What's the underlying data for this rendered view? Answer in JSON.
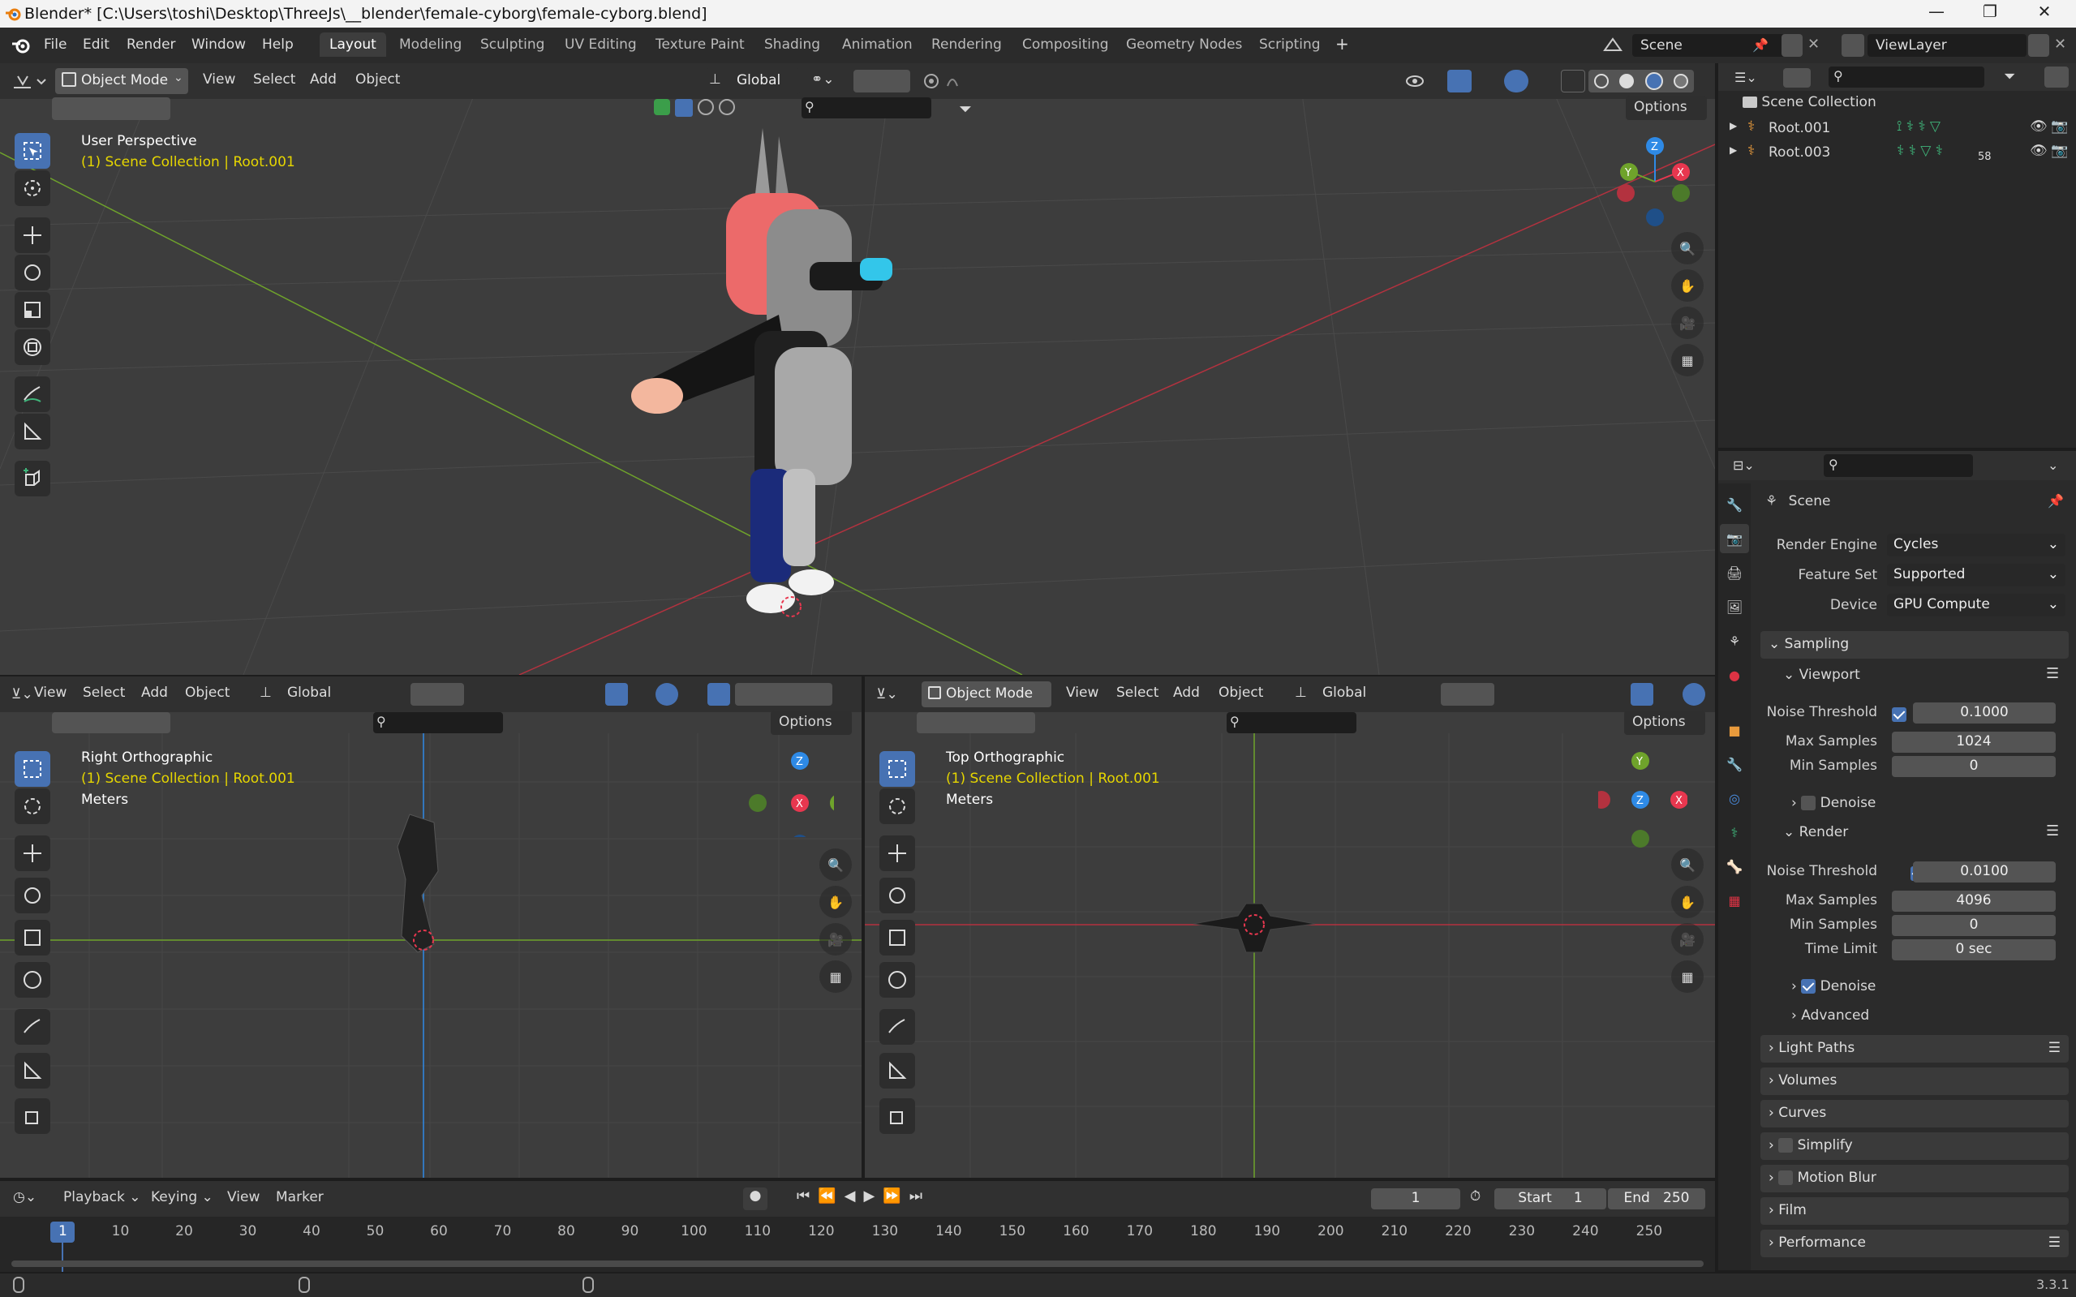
{
  "window": {
    "title": "Blender* [C:\\Users\\toshi\\Desktop\\ThreeJs\\__blender\\female-cyborg\\female-cyborg.blend]",
    "minimize": "—",
    "maximize": "❐",
    "close": "✕"
  },
  "menu": [
    "File",
    "Edit",
    "Render",
    "Window",
    "Help"
  ],
  "workspaces": [
    "Layout",
    "Modeling",
    "Sculpting",
    "UV Editing",
    "Texture Paint",
    "Shading",
    "Animation",
    "Rendering",
    "Compositing",
    "Geometry Nodes",
    "Scripting"
  ],
  "add_workspace": "+",
  "scene_name": "Scene",
  "view_layer": "ViewLayer",
  "main_view": {
    "mode": "Object Mode",
    "menus": [
      "View",
      "Select",
      "Add",
      "Object"
    ],
    "orientation": "Global",
    "options": "Options",
    "perspective": "User Perspective",
    "collection": "(1) Scene Collection | Root.001"
  },
  "left_view": {
    "menus": [
      "View",
      "Select",
      "Add",
      "Object"
    ],
    "orientation": "Global",
    "options": "Options",
    "perspective": "Right Orthographic",
    "collection": "(1) Scene Collection | Root.001",
    "units": "Meters"
  },
  "right_view": {
    "mode": "Object Mode",
    "menus": [
      "View",
      "Select",
      "Add",
      "Object"
    ],
    "orientation": "Global",
    "options": "Options",
    "perspective": "Top Orthographic",
    "collection": "(1) Scene Collection | Root.001",
    "units": "Meters"
  },
  "outliner": {
    "root": "Scene Collection",
    "items": [
      {
        "name": "Root.001"
      },
      {
        "name": "Root.003",
        "badge": "58"
      }
    ]
  },
  "properties": {
    "context": "Scene",
    "render_engine_label": "Render Engine",
    "render_engine": "Cycles",
    "feature_set_label": "Feature Set",
    "feature_set": "Supported",
    "device_label": "Device",
    "device": "GPU Compute",
    "sampling": "Sampling",
    "viewport": "Viewport",
    "vp_noise_label": "Noise Threshold",
    "vp_noise": "0.1000",
    "vp_max_label": "Max Samples",
    "vp_max": "1024",
    "vp_min_label": "Min Samples",
    "vp_min": "0",
    "denoise_label": "Denoise",
    "render": "Render",
    "r_noise_label": "Noise Threshold",
    "r_noise": "0.0100",
    "r_max_label": "Max Samples",
    "r_max": "4096",
    "r_min_label": "Min Samples",
    "r_min": "0",
    "time_limit_label": "Time Limit",
    "time_limit": "0 sec",
    "r_denoise_label": "Denoise",
    "advanced": "Advanced",
    "panels": [
      "Light Paths",
      "Volumes",
      "Curves",
      "Simplify",
      "Motion Blur",
      "Film",
      "Performance"
    ]
  },
  "timeline": {
    "menus": [
      "Playback",
      "Keying",
      "View",
      "Marker"
    ],
    "current_frame": "1",
    "start_label": "Start",
    "start": "1",
    "end_label": "End",
    "end": "250",
    "ticks": [
      "1",
      "10",
      "20",
      "30",
      "40",
      "50",
      "60",
      "70",
      "80",
      "90",
      "100",
      "110",
      "120",
      "130",
      "140",
      "150",
      "160",
      "170",
      "180",
      "190",
      "200",
      "210",
      "220",
      "230",
      "240",
      "250"
    ]
  },
  "version": "3.3.1",
  "colors": {
    "accent": "#4772b3",
    "x_axis": "#e8374f",
    "y_axis": "#6fa32b",
    "z_axis": "#2e8ae6",
    "yellow": "#e6d600"
  }
}
